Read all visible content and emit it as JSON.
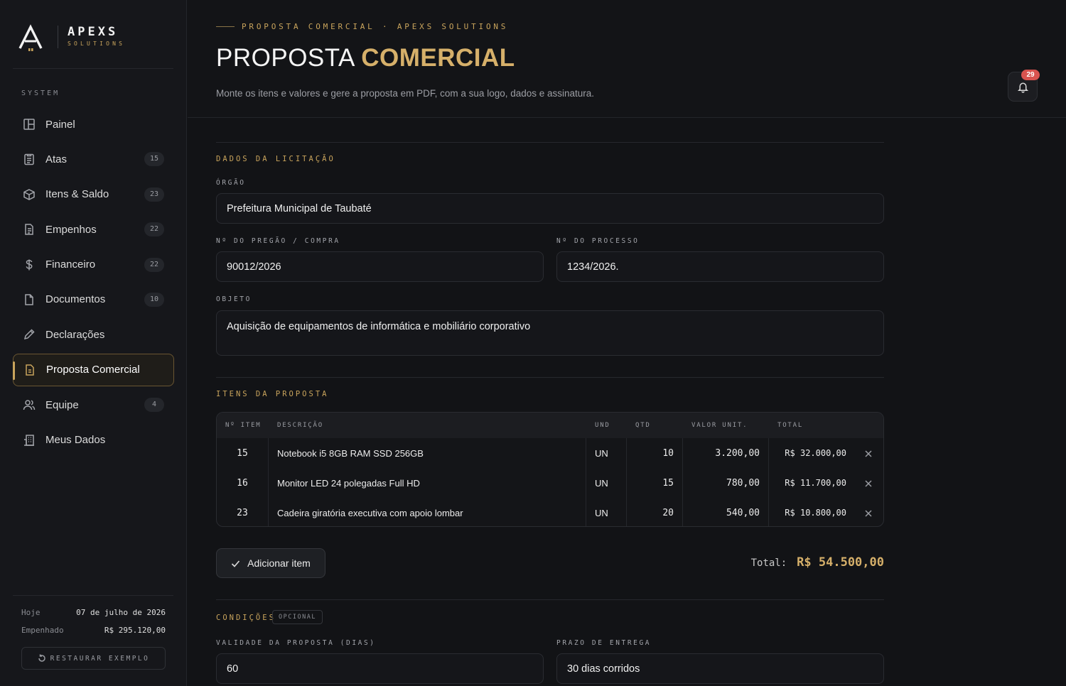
{
  "brand": {
    "name": "APEXS",
    "sub": "SOLUTIONS"
  },
  "sidebar": {
    "section": "SYSTEM",
    "items": [
      {
        "label": "Painel",
        "badge": "",
        "icon": "layout-icon"
      },
      {
        "label": "Atas",
        "badge": "15",
        "icon": "clipboard-icon"
      },
      {
        "label": "Itens & Saldo",
        "badge": "23",
        "icon": "box-icon"
      },
      {
        "label": "Empenhos",
        "badge": "22",
        "icon": "file-text-icon"
      },
      {
        "label": "Financeiro",
        "badge": "22",
        "icon": "dollar-icon"
      },
      {
        "label": "Documentos",
        "badge": "10",
        "icon": "document-icon"
      },
      {
        "label": "Declarações",
        "badge": "",
        "icon": "pencil-icon"
      },
      {
        "label": "Proposta Comercial",
        "badge": "",
        "icon": "file-sign-icon",
        "active": true
      },
      {
        "label": "Equipe",
        "badge": "4",
        "icon": "users-icon"
      },
      {
        "label": "Meus Dados",
        "badge": "",
        "icon": "building-icon"
      }
    ],
    "footer": {
      "today_label": "Hoje",
      "today_value": "07 de julho de 2026",
      "committed_label": "Empenhado",
      "committed_value": "R$ 295.120,00",
      "restore_label": "RESTAURAR EXEMPLO"
    }
  },
  "header": {
    "eyebrow": "PROPOSTA COMERCIAL · APEXS SOLUTIONS",
    "title_plain": "PROPOSTA",
    "title_accent": "COMERCIAL",
    "subtitle": "Monte os itens e valores e gere a proposta em PDF, com a sua logo, dados e assinatura.",
    "notifications": "29"
  },
  "licitacao": {
    "section": "DADOS DA LICITAÇÃO",
    "orgao_label": "ÓRGÃO",
    "orgao_value": "Prefeitura Municipal de Taubaté",
    "pregao_label": "Nº DO PREGÃO / COMPRA",
    "pregao_value": "90012/2026",
    "processo_label": "Nº DO PROCESSO",
    "processo_value": "1234/2026.",
    "objeto_label": "OBJETO",
    "objeto_value": "Aquisição de equipamentos de informática e mobiliário corporativo"
  },
  "itens": {
    "section": "ITENS DA PROPOSTA",
    "columns": [
      "Nº ITEM",
      "DESCRIÇÃO",
      "UND",
      "QTD",
      "VALOR UNIT.",
      "TOTAL"
    ],
    "rows": [
      {
        "num": "15",
        "desc": "Notebook i5 8GB RAM SSD 256GB",
        "und": "UN",
        "qtd": "10",
        "unit": "3.200,00",
        "total": "R$ 32.000,00"
      },
      {
        "num": "16",
        "desc": "Monitor LED 24 polegadas Full HD",
        "und": "UN",
        "qtd": "15",
        "unit": "780,00",
        "total": "R$ 11.700,00"
      },
      {
        "num": "23",
        "desc": "Cadeira giratória executiva com apoio lombar",
        "und": "UN",
        "qtd": "20",
        "unit": "540,00",
        "total": "R$ 10.800,00"
      }
    ],
    "add_label": "Adicionar item",
    "total_label": "Total:",
    "total_value": "R$ 54.500,00"
  },
  "condicoes": {
    "section": "CONDIÇÕES",
    "optional": "OPCIONAL",
    "validade_label": "VALIDADE DA PROPOSTA (DIAS)",
    "validade_value": "60",
    "prazo_label": "PRAZO DE ENTREGA",
    "prazo_value": "30 dias corridos"
  },
  "colors": {
    "accent": "#c9a45c",
    "background": "#121316",
    "alert": "#d9534f"
  }
}
